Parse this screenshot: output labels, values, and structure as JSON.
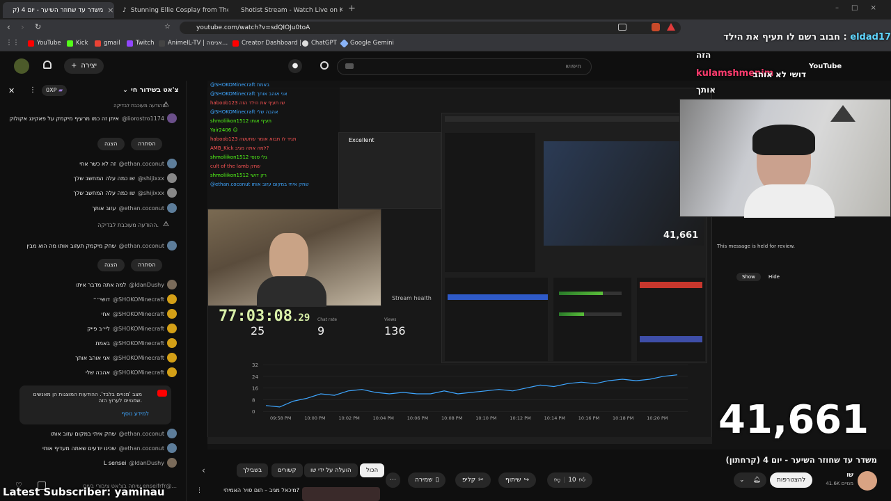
{
  "browser": {
    "tabs": [
      {
        "title": "משדר עד שחוזר השיער - יום 4 (ק"
      },
      {
        "title": "Stunning Ellie Cosplay from The Last"
      },
      {
        "title": "Shotist Stream - Watch Live on Kick"
      }
    ],
    "url": "youtube.com/watch?v=sdQIOJu0toA",
    "bookmarks": [
      "YouTube",
      "Kick",
      "gmail",
      "Twitch",
      "AnimeIL-TV | אנימה...",
      "Creator Dashboard |...",
      "ChatGPT",
      "Google Gemini"
    ]
  },
  "header": {
    "search_placeholder": "חיפוש",
    "create_label": "יצירה"
  },
  "chat": {
    "title": "צ'אט בשידור חי",
    "xp": "0XP",
    "rows": [
      {
        "author": "@liorostro1174",
        "msg": "איתן זה כמו מרעיף מיקמק על פאקינג אקולוקו",
        "color": "#6b4f8a"
      },
      {
        "author": "@ethan.coconut",
        "msg": "זה לא כשר אחי",
        "color": "#5d7d9a"
      },
      {
        "author": "@shijixxx",
        "msg": "שו כמה עלה המחשב שלך",
        "color": "#888"
      },
      {
        "author": "@shijixxx",
        "msg": "שו כמה עלה המחשב שלך",
        "color": "#888"
      },
      {
        "author": "@ethan.coconut",
        "msg": "עזוב אותך",
        "color": "#5d7d9a"
      },
      {
        "author": "@ethan.coconut",
        "msg": "שחק מיקמק תעזוב אותו מה הוא מבין",
        "color": "#5d7d9a"
      },
      {
        "author": "@IdanDushy",
        "msg": "למה אתה מדבר איתו",
        "color": "#7a6b5a"
      },
      {
        "author": "@SHOKOMinecraft",
        "msg": "דושי״״",
        "color": "#d4a017"
      },
      {
        "author": "@SHOKOMinecraft",
        "msg": "אחי",
        "color": "#d4a017"
      },
      {
        "author": "@SHOKOMinecraft",
        "msg": "ליי׳ב פייק",
        "color": "#d4a017"
      },
      {
        "author": "@SHOKOMinecraft",
        "msg": "באמת",
        "color": "#d4a017"
      },
      {
        "author": "@SHOKOMinecraft",
        "msg": "אני אוהב אותך",
        "color": "#d4a017"
      },
      {
        "author": "@SHOKOMinecraft",
        "msg": "אהבה שלי",
        "color": "#d4a017"
      },
      {
        "author": "@ethan.coconut",
        "msg": "שחק איתי במקום עזוב אותו",
        "color": "#5d7d9a"
      },
      {
        "author": "@ethan.coconut",
        "msg": "שכינו יודעים שאתה מעדיף אותי",
        "color": "#5d7d9a"
      },
      {
        "author": "@IdanDushy",
        "msg": "L sensei",
        "color": "#7a6b5a"
      }
    ],
    "held_note": "ההודעה מעוכבת לבדיקה.",
    "show": "הצגה",
    "hide": "הסתרה",
    "notice": "מצב 'מנויים בלבד'. ההודעות המוצגות הן מאנשים שמנויים לערוץ הזה.",
    "notice_link": "למידע נוסף",
    "input_placeholder": "שיחה בצ'אט ציבורי בשם enseifrfr@..."
  },
  "overlay": {
    "top_right_user": "eldad17",
    "top_right_msg": "חבוב רשם לו תעיף את הילד :",
    "line2": "הזה",
    "yt_label": "YouTube",
    "user2": "kulamshmenim",
    "msg2": "דושי לא אוהב",
    "line4": "אותך",
    "timer": "77:03:08",
    "timer_frac": ".29",
    "big_count": "41,661",
    "subscriber": "Latest Subscriber: yaminau",
    "stream_health": "Stream health",
    "stat1": "25",
    "stat2_label": "Chat rate",
    "stat2": "9",
    "stat3_label": "Views",
    "stat3": "136",
    "chart_times": [
      "09:58 PM",
      "10:00 PM",
      "10:02 PM",
      "10:04 PM",
      "10:06 PM",
      "10:08 PM",
      "10:10 PM",
      "10:12 PM",
      "10:14 PM",
      "10:16 PM",
      "10:18 PM",
      "10:20 PM"
    ],
    "chart_y": [
      "32",
      "24",
      "16",
      "8",
      "0"
    ],
    "obs_count": "41,661",
    "mini_excellent": "Excellent",
    "held_en": "This message is held for review.",
    "show_en": "Show",
    "hide_en": "Hide"
  },
  "video_info": {
    "title": "משדר עד שחוזר השיער - יום 4 (קרחתון)",
    "channel": "שו",
    "subs": "41.6K מנויים",
    "subscribe": "להצטרפות",
    "likes": "10",
    "share": "שיתוף",
    "clip": "קליפ",
    "save": "שמירה"
  },
  "chips": [
    "הכול",
    "הועלה על ידי שו",
    "קשורים",
    "בשבילך"
  ],
  "rec": {
    "title": "מיכאל מגיב – תום סויר האמיתי?"
  }
}
